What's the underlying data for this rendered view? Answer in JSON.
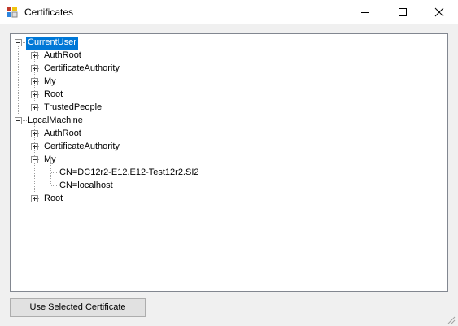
{
  "window": {
    "title": "Certificates",
    "icon": "certificate-app-icon"
  },
  "titlebar_buttons": {
    "minimize": "minimize-icon",
    "maximize": "maximize-icon",
    "close": "close-icon"
  },
  "tree": {
    "nodes": [
      {
        "label": "CurrentUser",
        "selected": true,
        "expanded": true
      },
      {
        "label": "AuthRoot",
        "expanded": false
      },
      {
        "label": "CertificateAuthority",
        "expanded": false
      },
      {
        "label": "My",
        "expanded": false
      },
      {
        "label": "Root",
        "expanded": false
      },
      {
        "label": "TrustedPeople",
        "expanded": false
      },
      {
        "label": "LocalMachine",
        "expanded": true
      },
      {
        "label": "AuthRoot",
        "expanded": false
      },
      {
        "label": "CertificateAuthority",
        "expanded": false
      },
      {
        "label": "My",
        "expanded": true
      },
      {
        "label": "CN=DC12r2-E12.E12-Test12r2.SI2"
      },
      {
        "label": "CN=localhost"
      },
      {
        "label": "Root",
        "expanded": false
      }
    ]
  },
  "actions": {
    "use_selected_label": "Use Selected Certificate"
  },
  "colors": {
    "selection": "#0078d7",
    "window_bg": "#f0f0f0",
    "border": "#828790"
  }
}
